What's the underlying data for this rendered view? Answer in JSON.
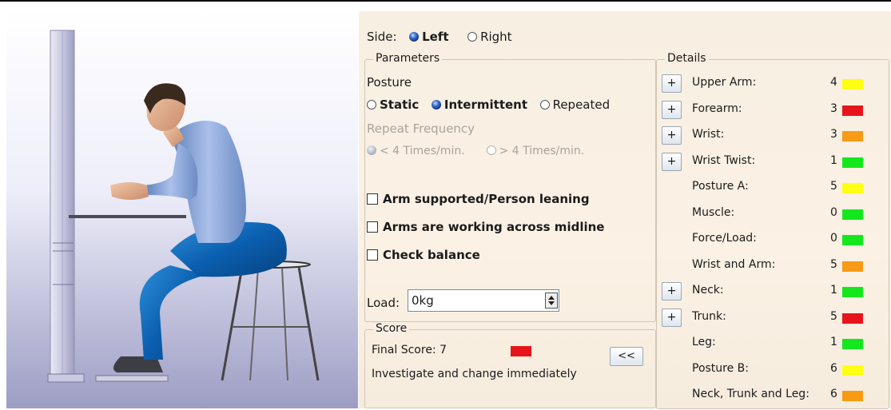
{
  "side": {
    "label": "Side:",
    "options": [
      "Left",
      "Right"
    ],
    "selected": "Left"
  },
  "parameters": {
    "legend": "Parameters",
    "posture_label": "Posture",
    "posture_options": [
      "Static",
      "Intermittent",
      "Repeated"
    ],
    "posture_selected": "Intermittent",
    "repeat_label": "Repeat Frequency",
    "repeat_options": [
      "< 4 Times/min.",
      "> 4 Times/min."
    ],
    "repeat_selected": "< 4 Times/min.",
    "checkboxes": [
      "Arm supported/Person leaning",
      "Arms are working across midline",
      "Check balance"
    ],
    "load_label": "Load:",
    "load_value": "0kg"
  },
  "score": {
    "legend": "Score",
    "final_label": "Final Score: 7",
    "final_color": "#e8141c",
    "message": "Investigate and change immediately",
    "collapse_button": "<<"
  },
  "details": {
    "legend": "Details",
    "rows": [
      {
        "label": "Upper Arm:",
        "value": "4",
        "color": "#ffff14",
        "expandable": true
      },
      {
        "label": "Forearm:",
        "value": "3",
        "color": "#e8141c",
        "expandable": true
      },
      {
        "label": "Wrist:",
        "value": "3",
        "color": "#f79a16",
        "expandable": true
      },
      {
        "label": "Wrist Twist:",
        "value": "1",
        "color": "#14e81c",
        "expandable": true
      },
      {
        "label": "Posture A:",
        "value": "5",
        "color": "#ffff14",
        "expandable": false
      },
      {
        "label": "Muscle:",
        "value": "0",
        "color": "#14e81c",
        "expandable": false
      },
      {
        "label": "Force/Load:",
        "value": "0",
        "color": "#14e81c",
        "expandable": false
      },
      {
        "label": "Wrist and Arm:",
        "value": "5",
        "color": "#f79a16",
        "expandable": false
      },
      {
        "label": "Neck:",
        "value": "1",
        "color": "#14e81c",
        "expandable": true
      },
      {
        "label": "Trunk:",
        "value": "5",
        "color": "#e8141c",
        "expandable": true
      },
      {
        "label": "Leg:",
        "value": "1",
        "color": "#14e81c",
        "expandable": false
      },
      {
        "label": "Posture B:",
        "value": "6",
        "color": "#ffff14",
        "expandable": false
      },
      {
        "label": "Neck, Trunk and Leg:",
        "value": "6",
        "color": "#f79a16",
        "expandable": false
      }
    ],
    "expand_label": "+"
  }
}
